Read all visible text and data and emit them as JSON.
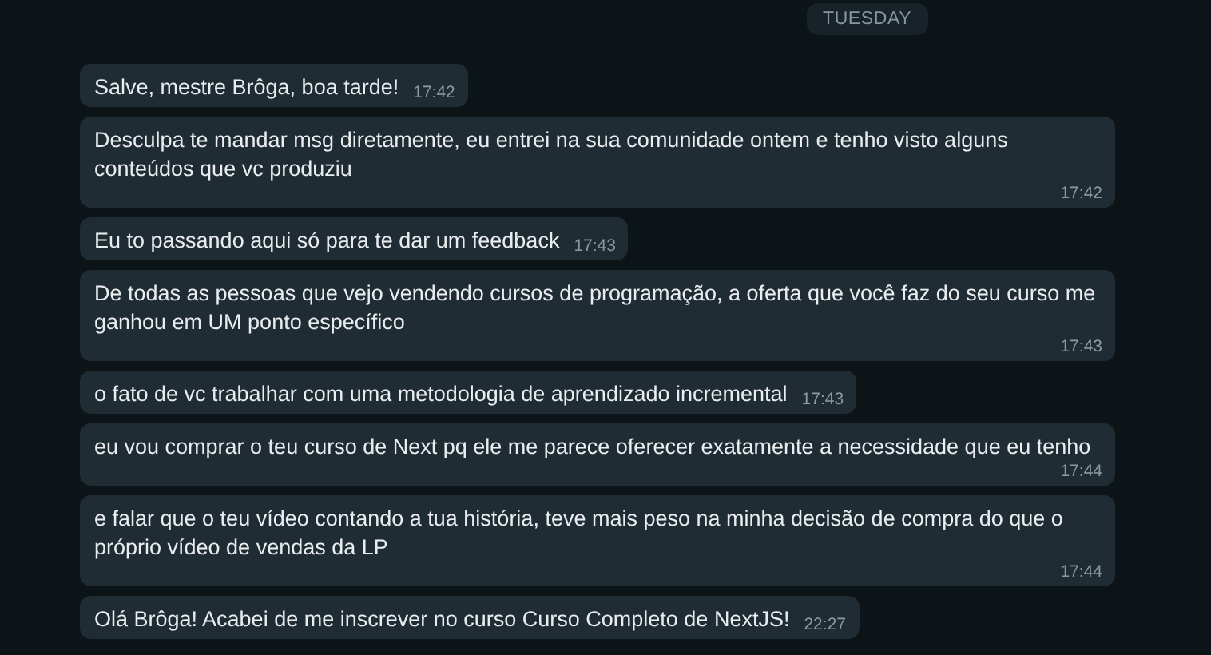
{
  "date_divider": "TUESDAY",
  "messages": [
    {
      "text": "Salve, mestre Brôga, boa tarde!",
      "time": "17:42"
    },
    {
      "text": "Desculpa te mandar msg diretamente, eu entrei na sua comunidade ontem e tenho visto alguns conteúdos que vc produziu",
      "time": "17:42"
    },
    {
      "text": "Eu to passando aqui só para te dar um feedback",
      "time": "17:43"
    },
    {
      "text": "De todas as pessoas que vejo vendendo cursos de programação, a oferta que você faz do seu curso me ganhou em UM ponto específico",
      "time": "17:43"
    },
    {
      "text": "o fato de vc trabalhar com uma metodologia de aprendizado incremental",
      "time": "17:43"
    },
    {
      "text": "eu vou comprar o teu curso de Next pq ele me parece oferecer exatamente a necessidade que eu tenho",
      "time": "17:44"
    },
    {
      "text": "e falar que o teu vídeo contando a tua história, teve mais peso na minha decisão de compra do que o próprio vídeo de vendas da LP",
      "time": "17:44"
    },
    {
      "text": "Olá Brôga! Acabei de me inscrever no curso Curso Completo de NextJS!",
      "time": "22:27"
    }
  ]
}
